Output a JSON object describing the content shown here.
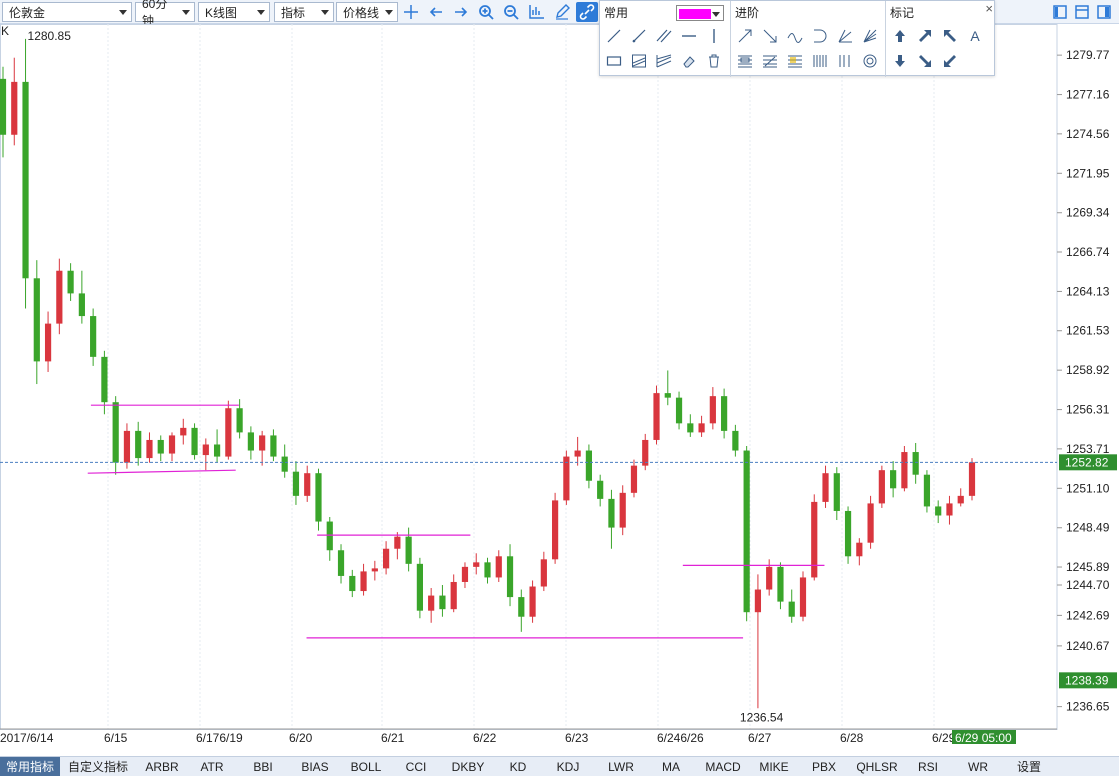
{
  "toolbar": {
    "symbol": "伦敦金",
    "period": "60分钟",
    "chart_type": "K线图",
    "indicator": "指标",
    "price_line": "价格线",
    "icons": [
      "crosshair-icon",
      "arrow-left-icon",
      "arrow-right-icon",
      "zoom-in-icon",
      "zoom-out-icon",
      "axis-icon",
      "pencil-icon",
      "link-icon"
    ],
    "window_icons": [
      "layout-single-icon",
      "layout-split-icon",
      "layout-grid-icon"
    ]
  },
  "panel": {
    "common_title": "常用",
    "advanced_title": "进阶",
    "marker_title": "标记",
    "color": "#ff00ff",
    "close": "×",
    "text_tool": "A"
  },
  "chart": {
    "k_label": "K",
    "high_label": "1280.85",
    "low_label": "1236.54",
    "current_price": "1252.82",
    "bid_price": "1238.39",
    "time_badge": "6/29 05:00",
    "price_ticks": [
      "1279.77",
      "1277.16",
      "1274.56",
      "1271.95",
      "1269.34",
      "1266.74",
      "1264.13",
      "1261.53",
      "1258.92",
      "1256.31",
      "1253.71",
      "1251.10",
      "1248.49",
      "1245.89",
      "1244.70",
      "1242.69",
      "1240.67",
      "1236.65"
    ],
    "date_labels": [
      "2017/6/14",
      "6/15",
      "6/176/19",
      "6/20",
      "6/21",
      "6/22",
      "6/23",
      "6/246/26",
      "6/27",
      "6/28",
      "6/29"
    ]
  },
  "colors": {
    "up": "#d9363e",
    "down": "#3aa52a",
    "trendline": "#e022d6",
    "current_line": "#4a7fc1",
    "badge_green": "#2f8f2f"
  },
  "chart_data": {
    "type": "candlestick",
    "title": "伦敦金",
    "period": "60分钟",
    "ylim": [
      1235.5,
      1281.5
    ],
    "series": [
      {
        "name": "伦敦金",
        "ohlc": [
          [
            1278.2,
            1279.0,
            1273.0,
            1274.5
          ],
          [
            1274.5,
            1279.6,
            1273.8,
            1278.0
          ],
          [
            1278.0,
            1280.85,
            1263.0,
            1265.0
          ],
          [
            1265.0,
            1266.2,
            1258.0,
            1259.5
          ],
          [
            1259.5,
            1262.8,
            1258.8,
            1262.0
          ],
          [
            1262.0,
            1266.3,
            1261.3,
            1265.5
          ],
          [
            1265.5,
            1266.0,
            1263.5,
            1264.0
          ],
          [
            1264.0,
            1265.5,
            1262.0,
            1262.5
          ],
          [
            1262.5,
            1263.0,
            1259.2,
            1259.8
          ],
          [
            1259.8,
            1260.2,
            1256.0,
            1256.8
          ],
          [
            1256.8,
            1257.2,
            1252.0,
            1252.8
          ],
          [
            1252.8,
            1255.4,
            1252.4,
            1254.9
          ],
          [
            1254.9,
            1255.5,
            1252.6,
            1253.1
          ],
          [
            1253.1,
            1254.8,
            1252.8,
            1254.3
          ],
          [
            1254.3,
            1254.6,
            1252.9,
            1253.4
          ],
          [
            1253.4,
            1254.8,
            1252.9,
            1254.6
          ],
          [
            1254.6,
            1255.7,
            1254.0,
            1255.1
          ],
          [
            1255.1,
            1255.4,
            1253.0,
            1253.3
          ],
          [
            1253.3,
            1254.4,
            1252.3,
            1254.0
          ],
          [
            1254.0,
            1255.0,
            1252.8,
            1253.2
          ],
          [
            1253.2,
            1256.9,
            1253.0,
            1256.4
          ],
          [
            1256.4,
            1257.0,
            1254.4,
            1254.8
          ],
          [
            1254.8,
            1255.2,
            1253.0,
            1253.6
          ],
          [
            1253.6,
            1254.9,
            1252.6,
            1254.6
          ],
          [
            1254.6,
            1255.0,
            1252.9,
            1253.2
          ],
          [
            1253.2,
            1254.0,
            1251.8,
            1252.2
          ],
          [
            1252.2,
            1252.9,
            1250.0,
            1250.6
          ],
          [
            1250.6,
            1252.6,
            1250.2,
            1252.1
          ],
          [
            1252.1,
            1252.4,
            1248.3,
            1248.9
          ],
          [
            1248.9,
            1249.2,
            1246.3,
            1247.0
          ],
          [
            1247.0,
            1247.4,
            1244.8,
            1245.3
          ],
          [
            1245.3,
            1245.7,
            1243.9,
            1244.3
          ],
          [
            1244.3,
            1246.1,
            1244.0,
            1245.6
          ],
          [
            1245.6,
            1246.3,
            1245.0,
            1245.8
          ],
          [
            1245.8,
            1247.6,
            1245.4,
            1247.1
          ],
          [
            1247.1,
            1248.2,
            1246.4,
            1247.9
          ],
          [
            1247.9,
            1248.5,
            1245.6,
            1246.1
          ],
          [
            1246.1,
            1246.5,
            1242.5,
            1243.0
          ],
          [
            1243.0,
            1244.5,
            1242.2,
            1244.0
          ],
          [
            1244.0,
            1244.7,
            1242.6,
            1243.1
          ],
          [
            1243.1,
            1245.4,
            1242.9,
            1244.9
          ],
          [
            1244.9,
            1246.2,
            1244.5,
            1245.9
          ],
          [
            1245.9,
            1246.8,
            1245.4,
            1246.2
          ],
          [
            1246.2,
            1246.5,
            1244.8,
            1245.2
          ],
          [
            1245.2,
            1247.0,
            1244.9,
            1246.6
          ],
          [
            1246.6,
            1247.4,
            1243.3,
            1243.9
          ],
          [
            1243.9,
            1244.4,
            1241.6,
            1242.6
          ],
          [
            1242.6,
            1245.0,
            1242.2,
            1244.6
          ],
          [
            1244.6,
            1246.9,
            1244.3,
            1246.4
          ],
          [
            1246.4,
            1250.8,
            1246.1,
            1250.3
          ],
          [
            1250.3,
            1253.6,
            1250.0,
            1253.2
          ],
          [
            1253.2,
            1254.5,
            1252.6,
            1253.6
          ],
          [
            1253.6,
            1254.0,
            1251.1,
            1251.6
          ],
          [
            1251.6,
            1252.0,
            1249.9,
            1250.4
          ],
          [
            1250.4,
            1251.0,
            1247.1,
            1248.5
          ],
          [
            1248.5,
            1251.3,
            1248.0,
            1250.8
          ],
          [
            1250.8,
            1253.0,
            1250.5,
            1252.6
          ],
          [
            1252.6,
            1254.7,
            1252.3,
            1254.3
          ],
          [
            1254.3,
            1257.9,
            1254.0,
            1257.4
          ],
          [
            1257.4,
            1258.9,
            1256.6,
            1257.1
          ],
          [
            1257.1,
            1257.5,
            1255.0,
            1255.4
          ],
          [
            1255.4,
            1256.0,
            1254.5,
            1254.8
          ],
          [
            1254.8,
            1255.9,
            1254.5,
            1255.4
          ],
          [
            1255.4,
            1257.8,
            1255.0,
            1257.2
          ],
          [
            1257.2,
            1257.7,
            1254.4,
            1254.9
          ],
          [
            1254.9,
            1255.3,
            1253.2,
            1253.6
          ],
          [
            1253.6,
            1253.9,
            1242.3,
            1242.9
          ],
          [
            1242.9,
            1245.4,
            1236.54,
            1244.4
          ],
          [
            1244.4,
            1246.4,
            1244.0,
            1245.9
          ],
          [
            1245.9,
            1246.2,
            1243.1,
            1243.6
          ],
          [
            1243.6,
            1244.4,
            1242.2,
            1242.6
          ],
          [
            1242.6,
            1245.6,
            1242.3,
            1245.2
          ],
          [
            1245.2,
            1250.7,
            1245.0,
            1250.2
          ],
          [
            1250.2,
            1252.6,
            1249.8,
            1252.1
          ],
          [
            1252.1,
            1252.5,
            1249.0,
            1249.6
          ],
          [
            1249.6,
            1249.9,
            1246.1,
            1246.6
          ],
          [
            1246.6,
            1247.8,
            1246.0,
            1247.5
          ],
          [
            1247.5,
            1250.6,
            1247.1,
            1250.1
          ],
          [
            1250.1,
            1252.6,
            1249.8,
            1252.3
          ],
          [
            1252.3,
            1252.9,
            1250.5,
            1251.1
          ],
          [
            1251.1,
            1253.9,
            1250.9,
            1253.5
          ],
          [
            1253.5,
            1254.1,
            1251.4,
            1252.0
          ],
          [
            1252.0,
            1252.3,
            1249.5,
            1249.9
          ],
          [
            1249.9,
            1250.3,
            1248.8,
            1249.3
          ],
          [
            1249.3,
            1250.6,
            1248.7,
            1250.1
          ],
          [
            1250.1,
            1251.1,
            1249.9,
            1250.6
          ],
          [
            1250.6,
            1253.1,
            1250.3,
            1252.82
          ]
        ]
      }
    ],
    "lines": [
      {
        "name": "resistance-1",
        "from": [
          0.086,
          1256.6
        ],
        "to": [
          0.226,
          1256.6
        ]
      },
      {
        "name": "support-1",
        "from": [
          0.083,
          1252.1
        ],
        "to": [
          0.223,
          1252.3
        ]
      },
      {
        "name": "resistance-2",
        "from": [
          0.3,
          1248.0
        ],
        "to": [
          0.445,
          1248.0
        ]
      },
      {
        "name": "support-2",
        "from": [
          0.29,
          1241.2
        ],
        "to": [
          0.703,
          1241.2
        ]
      },
      {
        "name": "resistance-3",
        "from": [
          0.646,
          1246.0
        ],
        "to": [
          0.78,
          1246.0
        ]
      }
    ]
  },
  "tabs": [
    "常用指标",
    "自定义指标",
    "ARBR",
    "ATR",
    "BBI",
    "BIAS",
    "BOLL",
    "CCI",
    "DKBY",
    "KD",
    "KDJ",
    "LWR",
    "MA",
    "MACD",
    "MIKE",
    "PBX",
    "QHLSR",
    "RSI",
    "WR",
    "设置"
  ]
}
